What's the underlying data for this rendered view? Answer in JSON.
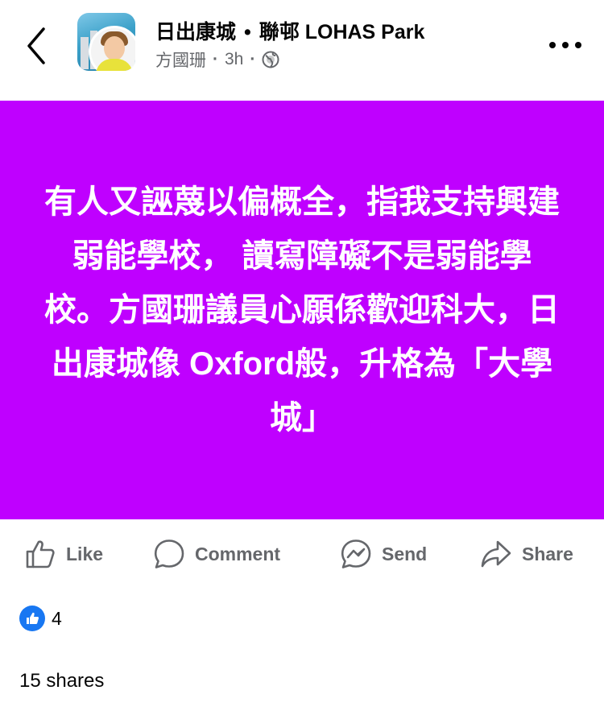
{
  "header": {
    "group_name": "日出康城",
    "title_dot": "•",
    "subgroup_name": "聯邨 LOHAS Park",
    "author": "方國珊",
    "meta_sep": "·",
    "time": "3h",
    "meta_sep2": "·",
    "privacy_icon": "globe-icon",
    "back_icon": "chevron-left-icon",
    "more_icon": "more-horizontal-icon"
  },
  "post": {
    "background_color": "#bf00ff",
    "text_color": "#ffffff",
    "text": "有人又誣蔑以偏概全，指我支持興建弱能學校， 讀寫障礙不是弱能學校。方國珊議員心願係歡迎科大，日出康城像 Oxford般，升格為「大學城」"
  },
  "actions": [
    {
      "label": "Like",
      "icon": "thumbs-up-icon"
    },
    {
      "label": "Comment",
      "icon": "comment-icon"
    },
    {
      "label": "Send",
      "icon": "messenger-icon"
    },
    {
      "label": "Share",
      "icon": "share-arrow-icon"
    }
  ],
  "reactions": {
    "icon": "like-badge-icon",
    "count": "4",
    "color": "#1877f2"
  },
  "shares": {
    "text": "15 shares"
  }
}
